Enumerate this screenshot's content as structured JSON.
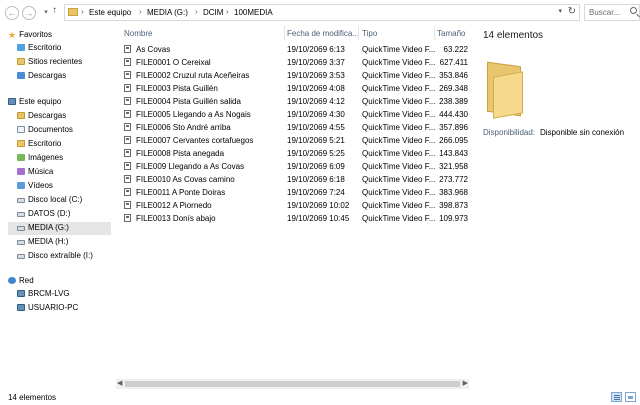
{
  "address": {
    "breadcrumbs": [
      "Este equipo",
      "MEDIA (G:)",
      "DCIM",
      "100MEDIA"
    ],
    "search_placeholder": "Buscar..."
  },
  "nav": {
    "favorites": {
      "label": "Favoritos",
      "items": [
        "Escritorio",
        "Sitios recientes",
        "Descargas"
      ]
    },
    "this_pc": {
      "label": "Este equipo",
      "items": [
        "Descargas",
        "Documentos",
        "Escritorio",
        "Imágenes",
        "Música",
        "Vídeos",
        "Disco local (C:)",
        "DATOS (D:)",
        "MEDIA (G:)",
        "MEDIA (H:)",
        "Disco extraíble (I:)"
      ]
    },
    "network": {
      "label": "Red",
      "items": [
        "BRCM-LVG",
        "USUARIO-PC"
      ]
    }
  },
  "columns": {
    "name": "Nombre",
    "date": "Fecha de modifica...",
    "type": "Tipo",
    "size": "Tamaño"
  },
  "files": [
    {
      "name": "As Covas",
      "date": "19/10/2069 6:13",
      "type": "QuickTime Video F...",
      "size": "63.222"
    },
    {
      "name": "FILE0001 O Cereixal",
      "date": "19/10/2069 3:37",
      "type": "QuickTime Video F...",
      "size": "627.411"
    },
    {
      "name": "FILE0002 Cruzul ruta Aceñeiras",
      "date": "19/10/2069 3:53",
      "type": "QuickTime Video F...",
      "size": "353.846"
    },
    {
      "name": "FILE0003 Pista Guillén",
      "date": "19/10/2069 4:08",
      "type": "QuickTime Video F...",
      "size": "269.348"
    },
    {
      "name": "FILE0004 Pista Guillén salida",
      "date": "19/10/2069 4:12",
      "type": "QuickTime Video F...",
      "size": "238.389"
    },
    {
      "name": "FILE0005 Llegando a As Nogais",
      "date": "19/10/2069 4:30",
      "type": "QuickTime Video F...",
      "size": "444.430"
    },
    {
      "name": "FILE0006 Sto André arriba",
      "date": "19/10/2069 4:55",
      "type": "QuickTime Video F...",
      "size": "357.896"
    },
    {
      "name": "FILE0007 Cervantes cortafuegos",
      "date": "19/10/2069 5:21",
      "type": "QuickTime Video F...",
      "size": "266.095"
    },
    {
      "name": "FILE0008 Pista anegada",
      "date": "19/10/2069 5:25",
      "type": "QuickTime Video F...",
      "size": "143.843"
    },
    {
      "name": "FILE009 Llegando a As Covas",
      "date": "19/10/2069 6:09",
      "type": "QuickTime Video F...",
      "size": "321.958"
    },
    {
      "name": "FILE0010 As  Covas camino",
      "date": "19/10/2069 6:18",
      "type": "QuickTime Video F...",
      "size": "273.772"
    },
    {
      "name": "FILE0011 A Ponte Doiras",
      "date": "19/10/2069 7:24",
      "type": "QuickTime Video F...",
      "size": "383.968"
    },
    {
      "name": "FILE0012 A Piornedo",
      "date": "19/10/2069 10:02",
      "type": "QuickTime Video F...",
      "size": "398.873"
    },
    {
      "name": "FILE0013 Donís abajo",
      "date": "19/10/2069 10:45",
      "type": "QuickTime Video F...",
      "size": "109.973"
    }
  ],
  "preview": {
    "count": "14 elementos",
    "availability_label": "Disponibilidad:",
    "availability_value": "Disponible sin conexión"
  },
  "status": {
    "text": "14 elementos"
  }
}
